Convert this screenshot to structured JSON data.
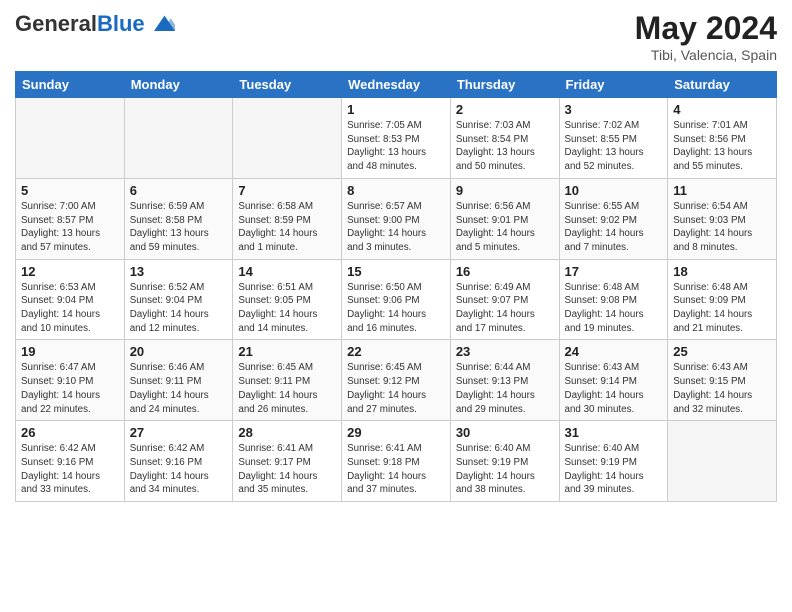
{
  "header": {
    "logo_general": "General",
    "logo_blue": "Blue",
    "month_title": "May 2024",
    "location": "Tibi, Valencia, Spain"
  },
  "weekdays": [
    "Sunday",
    "Monday",
    "Tuesday",
    "Wednesday",
    "Thursday",
    "Friday",
    "Saturday"
  ],
  "weeks": [
    [
      {
        "day": "",
        "info": ""
      },
      {
        "day": "",
        "info": ""
      },
      {
        "day": "",
        "info": ""
      },
      {
        "day": "1",
        "info": "Sunrise: 7:05 AM\nSunset: 8:53 PM\nDaylight: 13 hours\nand 48 minutes."
      },
      {
        "day": "2",
        "info": "Sunrise: 7:03 AM\nSunset: 8:54 PM\nDaylight: 13 hours\nand 50 minutes."
      },
      {
        "day": "3",
        "info": "Sunrise: 7:02 AM\nSunset: 8:55 PM\nDaylight: 13 hours\nand 52 minutes."
      },
      {
        "day": "4",
        "info": "Sunrise: 7:01 AM\nSunset: 8:56 PM\nDaylight: 13 hours\nand 55 minutes."
      }
    ],
    [
      {
        "day": "5",
        "info": "Sunrise: 7:00 AM\nSunset: 8:57 PM\nDaylight: 13 hours\nand 57 minutes."
      },
      {
        "day": "6",
        "info": "Sunrise: 6:59 AM\nSunset: 8:58 PM\nDaylight: 13 hours\nand 59 minutes."
      },
      {
        "day": "7",
        "info": "Sunrise: 6:58 AM\nSunset: 8:59 PM\nDaylight: 14 hours\nand 1 minute."
      },
      {
        "day": "8",
        "info": "Sunrise: 6:57 AM\nSunset: 9:00 PM\nDaylight: 14 hours\nand 3 minutes."
      },
      {
        "day": "9",
        "info": "Sunrise: 6:56 AM\nSunset: 9:01 PM\nDaylight: 14 hours\nand 5 minutes."
      },
      {
        "day": "10",
        "info": "Sunrise: 6:55 AM\nSunset: 9:02 PM\nDaylight: 14 hours\nand 7 minutes."
      },
      {
        "day": "11",
        "info": "Sunrise: 6:54 AM\nSunset: 9:03 PM\nDaylight: 14 hours\nand 8 minutes."
      }
    ],
    [
      {
        "day": "12",
        "info": "Sunrise: 6:53 AM\nSunset: 9:04 PM\nDaylight: 14 hours\nand 10 minutes."
      },
      {
        "day": "13",
        "info": "Sunrise: 6:52 AM\nSunset: 9:04 PM\nDaylight: 14 hours\nand 12 minutes."
      },
      {
        "day": "14",
        "info": "Sunrise: 6:51 AM\nSunset: 9:05 PM\nDaylight: 14 hours\nand 14 minutes."
      },
      {
        "day": "15",
        "info": "Sunrise: 6:50 AM\nSunset: 9:06 PM\nDaylight: 14 hours\nand 16 minutes."
      },
      {
        "day": "16",
        "info": "Sunrise: 6:49 AM\nSunset: 9:07 PM\nDaylight: 14 hours\nand 17 minutes."
      },
      {
        "day": "17",
        "info": "Sunrise: 6:48 AM\nSunset: 9:08 PM\nDaylight: 14 hours\nand 19 minutes."
      },
      {
        "day": "18",
        "info": "Sunrise: 6:48 AM\nSunset: 9:09 PM\nDaylight: 14 hours\nand 21 minutes."
      }
    ],
    [
      {
        "day": "19",
        "info": "Sunrise: 6:47 AM\nSunset: 9:10 PM\nDaylight: 14 hours\nand 22 minutes."
      },
      {
        "day": "20",
        "info": "Sunrise: 6:46 AM\nSunset: 9:11 PM\nDaylight: 14 hours\nand 24 minutes."
      },
      {
        "day": "21",
        "info": "Sunrise: 6:45 AM\nSunset: 9:11 PM\nDaylight: 14 hours\nand 26 minutes."
      },
      {
        "day": "22",
        "info": "Sunrise: 6:45 AM\nSunset: 9:12 PM\nDaylight: 14 hours\nand 27 minutes."
      },
      {
        "day": "23",
        "info": "Sunrise: 6:44 AM\nSunset: 9:13 PM\nDaylight: 14 hours\nand 29 minutes."
      },
      {
        "day": "24",
        "info": "Sunrise: 6:43 AM\nSunset: 9:14 PM\nDaylight: 14 hours\nand 30 minutes."
      },
      {
        "day": "25",
        "info": "Sunrise: 6:43 AM\nSunset: 9:15 PM\nDaylight: 14 hours\nand 32 minutes."
      }
    ],
    [
      {
        "day": "26",
        "info": "Sunrise: 6:42 AM\nSunset: 9:16 PM\nDaylight: 14 hours\nand 33 minutes."
      },
      {
        "day": "27",
        "info": "Sunrise: 6:42 AM\nSunset: 9:16 PM\nDaylight: 14 hours\nand 34 minutes."
      },
      {
        "day": "28",
        "info": "Sunrise: 6:41 AM\nSunset: 9:17 PM\nDaylight: 14 hours\nand 35 minutes."
      },
      {
        "day": "29",
        "info": "Sunrise: 6:41 AM\nSunset: 9:18 PM\nDaylight: 14 hours\nand 37 minutes."
      },
      {
        "day": "30",
        "info": "Sunrise: 6:40 AM\nSunset: 9:19 PM\nDaylight: 14 hours\nand 38 minutes."
      },
      {
        "day": "31",
        "info": "Sunrise: 6:40 AM\nSunset: 9:19 PM\nDaylight: 14 hours\nand 39 minutes."
      },
      {
        "day": "",
        "info": ""
      }
    ]
  ]
}
